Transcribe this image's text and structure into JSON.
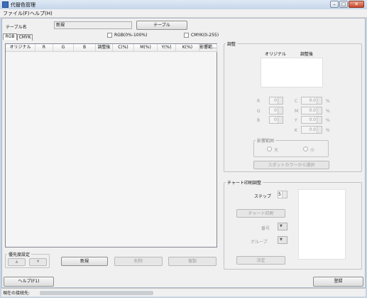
{
  "window": {
    "title": "代替色管理",
    "controls": [
      "–",
      "□",
      "✕"
    ]
  },
  "menu": [
    {
      "label": "ファイル(F)"
    },
    {
      "label": "ヘルプ(H)"
    }
  ],
  "table_name": {
    "label": "テーブル名",
    "value": "新規",
    "button": "テーブル"
  },
  "tabs": [
    {
      "label": "RGB"
    },
    {
      "label": "CMYK"
    }
  ],
  "checks": {
    "rgb": "RGB(0%-100%)",
    "cmyk": "CMYK(0-255)"
  },
  "grid": {
    "columns": [
      "オリジナル",
      "R",
      "G",
      "B",
      "調整後",
      "C(%)",
      "M(%)",
      "Y(%)",
      "K(%)",
      "影響範..."
    ]
  },
  "priority": {
    "legend": "優先度設定",
    "up": "▲",
    "down": "▼"
  },
  "list_buttons": {
    "new": "新規",
    "delete": "削除",
    "copy": "複製"
  },
  "adjust": {
    "legend": "調整",
    "original": "オリジナル",
    "adjusted": "調整後",
    "rgb": [
      {
        "label": "R",
        "value": "0"
      },
      {
        "label": "G",
        "value": "0"
      },
      {
        "label": "B",
        "value": "0"
      }
    ],
    "cmyk": [
      {
        "label": "C",
        "value": "0.0",
        "unit": "%"
      },
      {
        "label": "M",
        "value": "0.0",
        "unit": "%"
      },
      {
        "label": "Y",
        "value": "0.0",
        "unit": "%"
      },
      {
        "label": "K",
        "value": "0.0",
        "unit": "%"
      }
    ],
    "range_legend": "影響範囲",
    "range_large": "大",
    "range_small": "小",
    "spot_button": "スポットカラーから選択"
  },
  "chart": {
    "legend": "チャート印刷調整",
    "step_label": "ステップ",
    "step_value": "5",
    "print_button": "チャート印刷",
    "number_label": "番号",
    "group_label": "グループ",
    "decide_button": "決定"
  },
  "footer": {
    "help": "ヘルプ(F1)",
    "register": "登録"
  },
  "status": {
    "label": "現在の接続先:"
  }
}
